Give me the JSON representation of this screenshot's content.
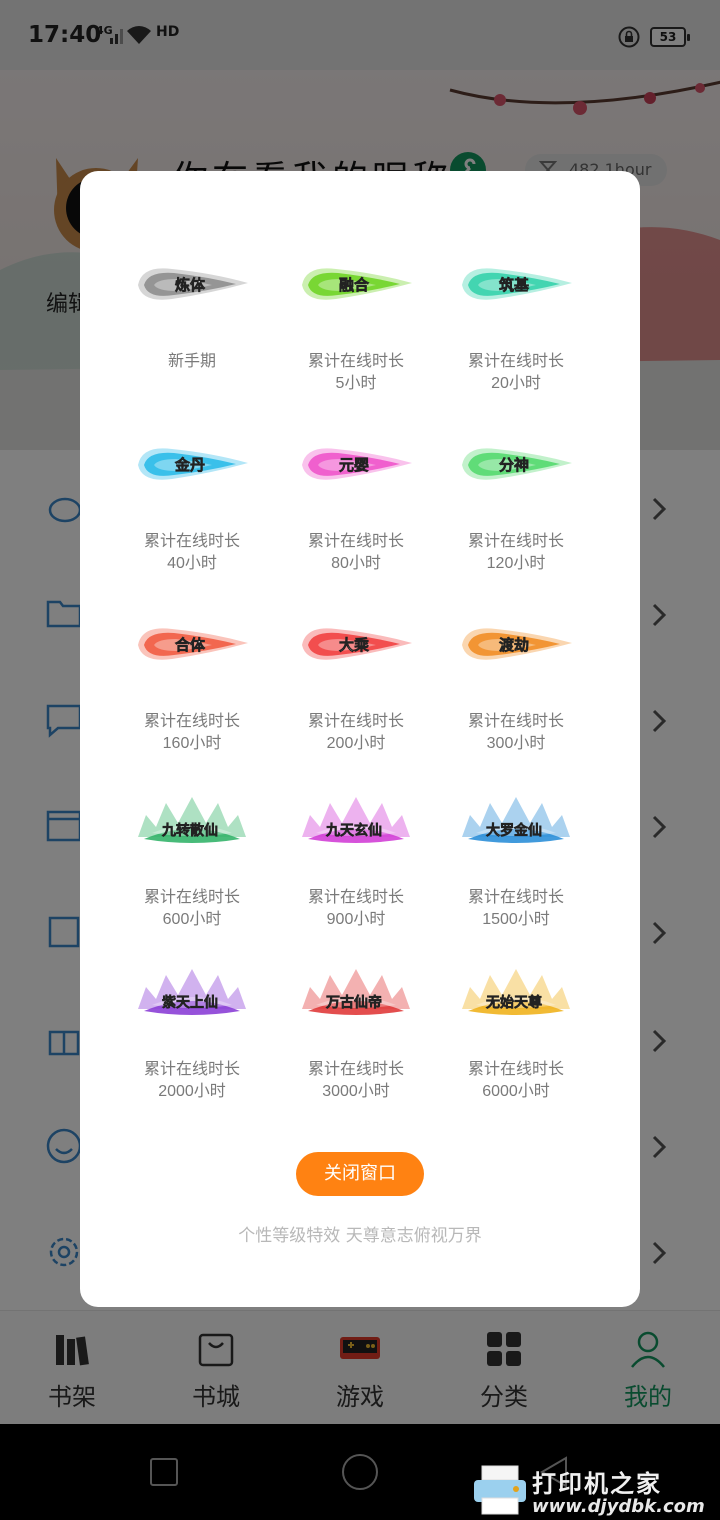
{
  "status_bar": {
    "time": "17:40",
    "network": "4G",
    "hd": "HD",
    "battery": "53"
  },
  "profile": {
    "nickname": "你在看我的昵称",
    "reading_time": "482.1hour",
    "edit_link": "编辑"
  },
  "badges_modal": {
    "badges": [
      {
        "name": "炼体",
        "line1": "新手期",
        "line2": "",
        "color": "#8a8a8a"
      },
      {
        "name": "融合",
        "line1": "累计在线时长",
        "line2": "5小时",
        "color": "#6bd21e"
      },
      {
        "name": "筑基",
        "line1": "累计在线时长",
        "line2": "20小时",
        "color": "#2fd0a8"
      },
      {
        "name": "金丹",
        "line1": "累计在线时长",
        "line2": "40小时",
        "color": "#25b8e8"
      },
      {
        "name": "元婴",
        "line1": "累计在线时长",
        "line2": "80小时",
        "color": "#ee4fc9"
      },
      {
        "name": "分神",
        "line1": "累计在线时长",
        "line2": "120小时",
        "color": "#4fd86a"
      },
      {
        "name": "合体",
        "line1": "累计在线时长",
        "line2": "160小时",
        "color": "#f0573c"
      },
      {
        "name": "大乘",
        "line1": "累计在线时长",
        "line2": "200小时",
        "color": "#f03b3b"
      },
      {
        "name": "渡劫",
        "line1": "累计在线时长",
        "line2": "300小时",
        "color": "#f08a1e"
      },
      {
        "name": "九转散仙",
        "line1": "累计在线时长",
        "line2": "600小时",
        "color": "#34b46a"
      },
      {
        "name": "九天玄仙",
        "line1": "累计在线时长",
        "line2": "900小时",
        "color": "#d13fd6"
      },
      {
        "name": "大罗金仙",
        "line1": "累计在线时长",
        "line2": "1500小时",
        "color": "#2c8fd8"
      },
      {
        "name": "紫天上仙",
        "line1": "累计在线时长",
        "line2": "2000小时",
        "color": "#8b3fd6"
      },
      {
        "name": "万古仙帝",
        "line1": "累计在线时长",
        "line2": "3000小时",
        "color": "#e03b3b"
      },
      {
        "name": "无始天尊",
        "line1": "累计在线时长",
        "line2": "6000小时",
        "color": "#f0b21e"
      }
    ],
    "close_label": "关闭窗口",
    "footer": "个性等级特效 天尊意志俯视万界"
  },
  "bottom_nav": {
    "items": [
      {
        "label": "书架",
        "icon": "bookshelf-icon"
      },
      {
        "label": "书城",
        "icon": "bookstore-bag-icon"
      },
      {
        "label": "游戏",
        "icon": "game-console-icon"
      },
      {
        "label": "分类",
        "icon": "category-grid-icon"
      },
      {
        "label": "我的",
        "icon": "profile-person-icon"
      }
    ],
    "active_color": "#13965f",
    "accent_color": "#ff8212"
  },
  "watermark": {
    "main": "打印机之家",
    "url": "www.djydbk.com"
  }
}
